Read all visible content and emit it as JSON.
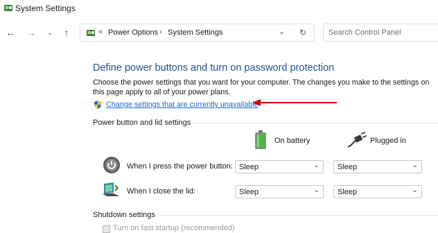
{
  "window": {
    "title": "System Settings",
    "icon": "control-panel-icon"
  },
  "nav": {
    "back_icon": "back-arrow-icon",
    "forward_icon": "forward-arrow-icon",
    "recent_icon": "chevron-down-icon",
    "up_icon": "up-arrow-icon"
  },
  "address": {
    "overflow": "«",
    "crumb1": "Power Options",
    "separator": "›",
    "crumb2": "System Settings",
    "dropdown_icon": "chevron-down-icon",
    "refresh_icon": "refresh-icon"
  },
  "search": {
    "placeholder": "Search Control Panel"
  },
  "main": {
    "heading": "Define power buttons and turn on password protection",
    "description": "Choose the power settings that you want for your computer. The changes you make to the settings on this page apply to all of your power plans.",
    "change_link": "Change settings that are currently unavailable",
    "annotation_color": "#d40000"
  },
  "power_section": {
    "label": "Power button and lid settings",
    "col_battery": "On battery",
    "col_plugged": "Plugged in",
    "rows": [
      {
        "label": "When I press the power button:",
        "battery": "Sleep",
        "plugged": "Sleep"
      },
      {
        "label": "When I close the lid:",
        "battery": "Sleep",
        "plugged": "Sleep"
      }
    ]
  },
  "shutdown_section": {
    "label": "Shutdown settings",
    "fast_startup": "Turn on fast startup (recommended)"
  }
}
